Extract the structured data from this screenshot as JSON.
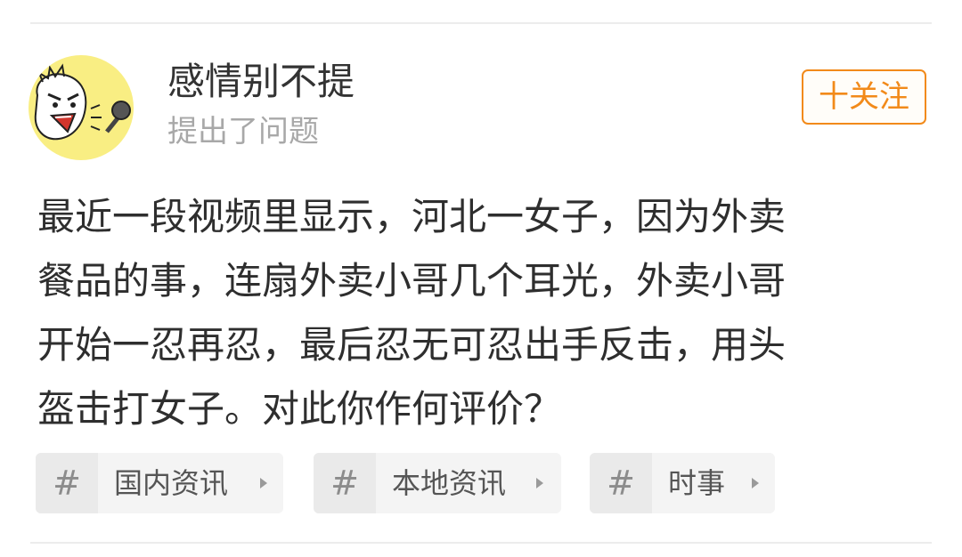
{
  "post": {
    "author_name": "感情别不提",
    "action_text": "提出了问题",
    "follow_label": "十关注",
    "question_lines": [
      "最近一段视频里显示，河北一女子，因为外卖",
      "餐品的事，连扇外卖小哥几个耳光，外卖小哥",
      "开始一忍再忍，最后忍无可忍出手反击，用头",
      "盔击打女子。对此你作何评价？"
    ]
  },
  "topics": [
    {
      "hash": "#",
      "label": "国内资讯"
    },
    {
      "hash": "#",
      "label": "本地资讯"
    },
    {
      "hash": "#",
      "label": "时事"
    }
  ],
  "colors": {
    "accent": "#f28a1a",
    "avatar_bg": "#f9ee83",
    "text_primary": "#2e2e2e",
    "text_secondary": "#a8a8a8",
    "chip_bg": "#f4f4f4"
  },
  "icons": {
    "avatar": "cartoon-shouting-face-with-microphone",
    "topic_marker": "hash-icon",
    "topic_chevron": "chevron-right-icon"
  }
}
